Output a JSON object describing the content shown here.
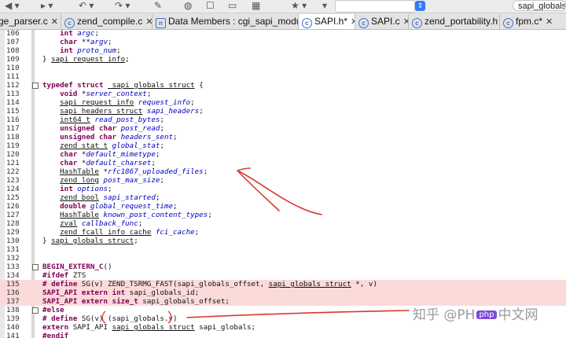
{
  "toolbar": {
    "search_value": "sapi_globals"
  },
  "tabs": [
    {
      "label": "ge_parser.c",
      "icon": "c"
    },
    {
      "label": "zend_compile.c",
      "icon": "c"
    },
    {
      "label": "Data Members : cgi_sapi_module",
      "icon": "n"
    },
    {
      "label": "SAPI.h*",
      "icon": "c"
    },
    {
      "label": "SAPI.c",
      "icon": "c"
    },
    {
      "label": "zend_portability.h",
      "icon": "c"
    },
    {
      "label": "fpm.c*",
      "icon": "c"
    }
  ],
  "code": {
    "lines": [
      {
        "num": "106",
        "text": "    int argc;"
      },
      {
        "num": "107",
        "text": "    char **argv;"
      },
      {
        "num": "108",
        "text": "    int proto_num;"
      },
      {
        "num": "109",
        "text": "} sapi_request_info;"
      },
      {
        "num": "110",
        "text": ""
      },
      {
        "num": "111",
        "text": ""
      },
      {
        "num": "112",
        "text": "typedef struct _sapi_globals_struct {"
      },
      {
        "num": "113",
        "text": "    void *server_context;"
      },
      {
        "num": "114",
        "text": "    sapi_request_info request_info;"
      },
      {
        "num": "115",
        "text": "    sapi_headers_struct sapi_headers;"
      },
      {
        "num": "116",
        "text": "    int64_t read_post_bytes;"
      },
      {
        "num": "117",
        "text": "    unsigned char post_read;"
      },
      {
        "num": "118",
        "text": "    unsigned char headers_sent;"
      },
      {
        "num": "119",
        "text": "    zend_stat_t global_stat;"
      },
      {
        "num": "120",
        "text": "    char *default_mimetype;"
      },
      {
        "num": "121",
        "text": "    char *default_charset;"
      },
      {
        "num": "122",
        "text": "    HashTable *rfc1867_uploaded_files;"
      },
      {
        "num": "123",
        "text": "    zend_long post_max_size;"
      },
      {
        "num": "124",
        "text": "    int options;"
      },
      {
        "num": "125",
        "text": "    zend_bool sapi_started;"
      },
      {
        "num": "126",
        "text": "    double global_request_time;"
      },
      {
        "num": "127",
        "text": "    HashTable known_post_content_types;"
      },
      {
        "num": "128",
        "text": "    zval callback_func;"
      },
      {
        "num": "129",
        "text": "    zend_fcall_info_cache fci_cache;"
      },
      {
        "num": "130",
        "text": "} sapi_globals_struct;"
      },
      {
        "num": "131",
        "text": ""
      },
      {
        "num": "132",
        "text": ""
      },
      {
        "num": "133",
        "text": "BEGIN_EXTERN_C()"
      },
      {
        "num": "134",
        "text": "#ifdef ZTS"
      },
      {
        "num": "135",
        "text": "# define SG(v) ZEND_TSRMG_FAST(sapi_globals_offset, sapi_globals_struct *, v)"
      },
      {
        "num": "136",
        "text": "SAPI_API extern int sapi_globals_id;"
      },
      {
        "num": "137",
        "text": "SAPI_API extern size_t sapi_globals_offset;"
      },
      {
        "num": "138",
        "text": "#else"
      },
      {
        "num": "139",
        "text": "# define SG(v) (sapi_globals.v)"
      },
      {
        "num": "140",
        "text": "extern SAPI_API sapi_globals_struct sapi_globals;"
      },
      {
        "num": "141",
        "text": "#endif"
      }
    ]
  },
  "watermark": {
    "text_left": "知乎 @PH",
    "logo_text": "php",
    "text_right": "中文网"
  },
  "colors": {
    "highlight_row": "#fbdada",
    "annotation_stroke": "#d93a2b",
    "keyword": "#7f0055",
    "field": "#0000c0"
  }
}
